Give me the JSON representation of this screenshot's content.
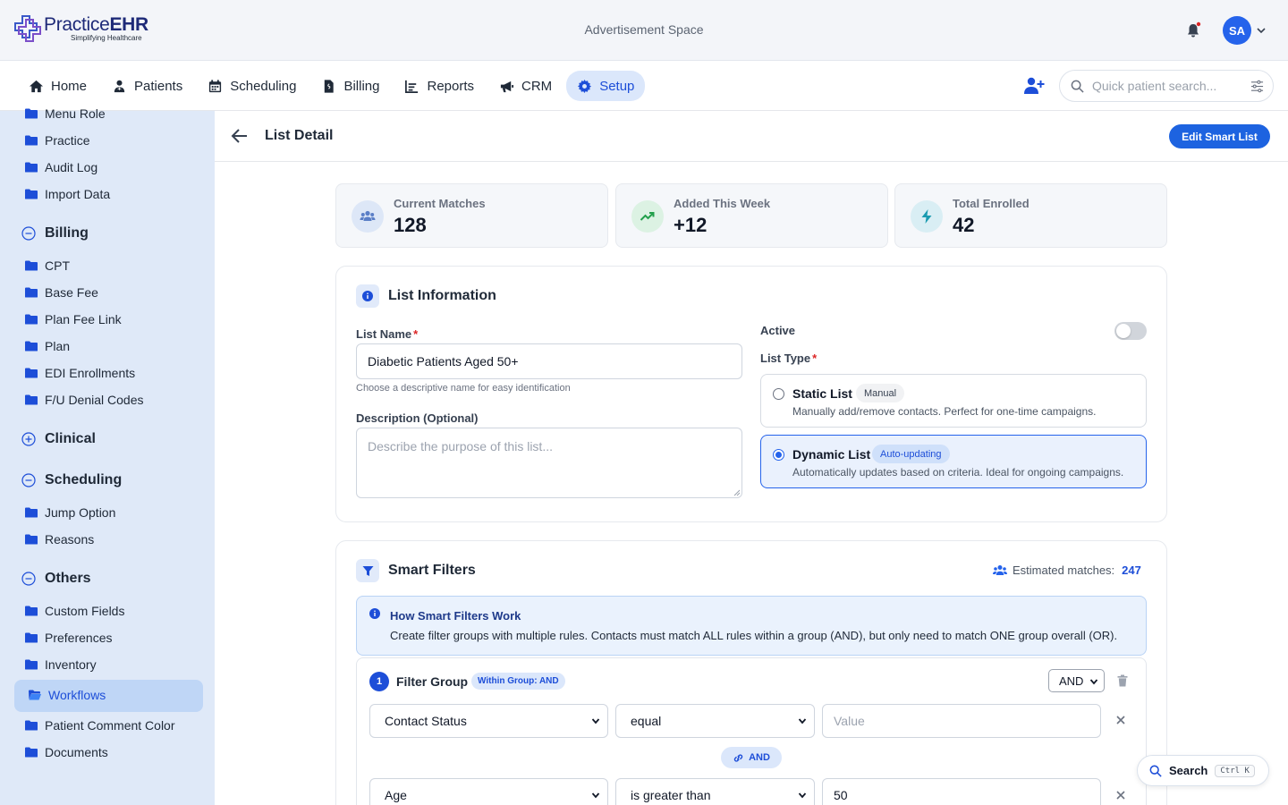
{
  "header": {
    "logo_brand_a": "Practice",
    "logo_brand_b": "EHR",
    "logo_tagline": "Simplifying Healthcare",
    "ad_space": "Advertisement Space",
    "avatar_initials": "SA"
  },
  "nav": {
    "items": [
      {
        "label": "Home",
        "icon": "home-icon"
      },
      {
        "label": "Patients",
        "icon": "patient-icon"
      },
      {
        "label": "Scheduling",
        "icon": "calendar-icon"
      },
      {
        "label": "Billing",
        "icon": "invoice-icon"
      },
      {
        "label": "Reports",
        "icon": "chart-icon"
      },
      {
        "label": "CRM",
        "icon": "megaphone-icon"
      },
      {
        "label": "Setup",
        "icon": "gear-icon",
        "active": true
      }
    ],
    "search_placeholder": "Quick patient search..."
  },
  "sidebar": {
    "top_items": [
      "Menu Role",
      "Practice",
      "Audit Log",
      "Import Data"
    ],
    "billing": {
      "title": "Billing",
      "items": [
        "CPT",
        "Base Fee",
        "Plan Fee Link",
        "Plan",
        "EDI Enrollments",
        "F/U Denial Codes"
      ]
    },
    "clinical": {
      "title": "Clinical"
    },
    "scheduling": {
      "title": "Scheduling",
      "items": [
        "Jump Option",
        "Reasons"
      ]
    },
    "others": {
      "title": "Others",
      "items": [
        "Custom Fields",
        "Preferences",
        "Inventory",
        "Workflows",
        "Patient Comment Color",
        "Documents"
      ]
    },
    "active_item": "Workflows"
  },
  "page": {
    "title": "List Detail",
    "edit_button": "Edit Smart List"
  },
  "stats": [
    {
      "label": "Current Matches",
      "value": "128"
    },
    {
      "label": "Added This Week",
      "value": "+12"
    },
    {
      "label": "Total Enrolled",
      "value": "42"
    }
  ],
  "list_info": {
    "title": "List Information",
    "name_label": "List Name",
    "name_value": "Diabetic Patients Aged 50+",
    "name_hint": "Choose a descriptive name for easy identification",
    "desc_label": "Description (Optional)",
    "desc_placeholder": "Describe the purpose of this list...",
    "active_label": "Active",
    "active_on": false,
    "type_label": "List Type",
    "types": [
      {
        "name": "Static List",
        "badge": "Manual",
        "desc": "Manually add/remove contacts. Perfect for one-time campaigns.",
        "selected": false
      },
      {
        "name": "Dynamic List",
        "badge": "Auto-updating",
        "desc": "Automatically updates based on criteria. Ideal for ongoing campaigns.",
        "selected": true
      }
    ]
  },
  "smart_filters": {
    "title": "Smart Filters",
    "est_label": "Estimated matches:",
    "est_value": "247",
    "info_title": "How Smart Filters Work",
    "info_text": "Create filter groups with multiple rules. Contacts must match ALL rules within a group (AND), but only need to match ONE group overall (OR).",
    "group": {
      "number": "1",
      "title": "Filter Group",
      "badge": "Within Group: AND",
      "operator": "AND",
      "rules": [
        {
          "field": "Contact Status",
          "op": "equal",
          "value": "",
          "placeholder": "Value"
        },
        {
          "field": "Age",
          "op": "is greater than",
          "value": "50",
          "placeholder": "Value"
        }
      ],
      "connector": "AND"
    }
  },
  "floating_search": {
    "label": "Search",
    "shortcut": "Ctrl K"
  },
  "colors": {
    "primary": "#1d63e0",
    "sidebar_bg": "#dfe9f8",
    "nav_active_bg": "#dbe7fb"
  }
}
